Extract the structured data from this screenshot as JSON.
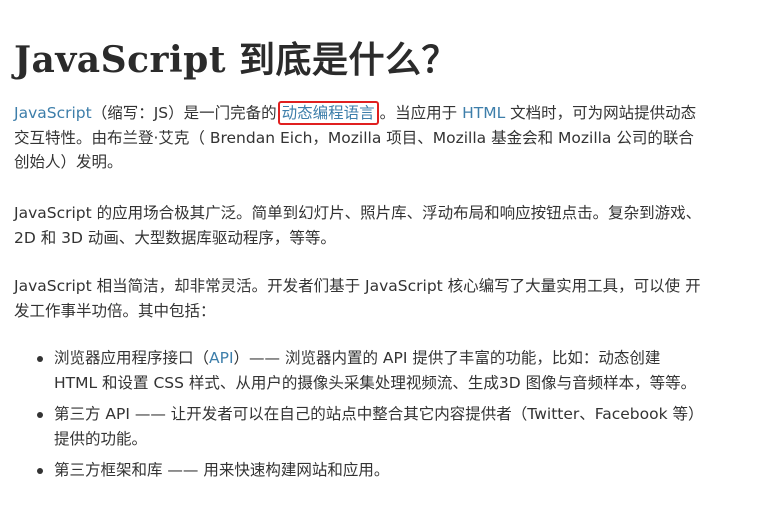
{
  "heading": "JavaScript 到底是什么？",
  "para1": {
    "link_js": "JavaScript",
    "text_a": "（缩写：JS）是一门完备的",
    "link_dynamic": "动态编程语言",
    "text_b": "。当应用于 ",
    "link_html": "HTML",
    "text_c": " 文档时，可为网站提供动态交互特性。由布兰登·艾克（ Brendan Eich，Mozilla 项目、Mozilla 基金会和 Mozilla 公司的联合创始人）发明。"
  },
  "para2": "JavaScript 的应用场合极其广泛。简单到幻灯片、照片库、浮动布局和响应按钮点击。复杂到游戏、2D 和 3D 动画、大型数据库驱动程序，等等。",
  "para3": "JavaScript 相当简洁，却非常灵活。开发者们基于 JavaScript 核心编写了大量实用工具，可以使 开发工作事半功倍。其中包括：",
  "list": {
    "item1_a": "浏览器应用程序接口（",
    "item1_link": "API",
    "item1_b": "）—— 浏览器内置的 API 提供了丰富的功能，比如：动态创建 HTML 和设置 CSS 样式、从用户的摄像头采集处理视频流、生成3D 图像与音频样本，等等。",
    "item2": "第三方 API —— 让开发者可以在自己的站点中整合其它内容提供者（Twitter、Facebook 等）提供的功能。",
    "item3": "第三方框架和库 —— 用来快速构建网站和应用。"
  },
  "colors": {
    "link": "#3d7eaa",
    "highlight_border": "#e02020",
    "text": "#333333"
  }
}
